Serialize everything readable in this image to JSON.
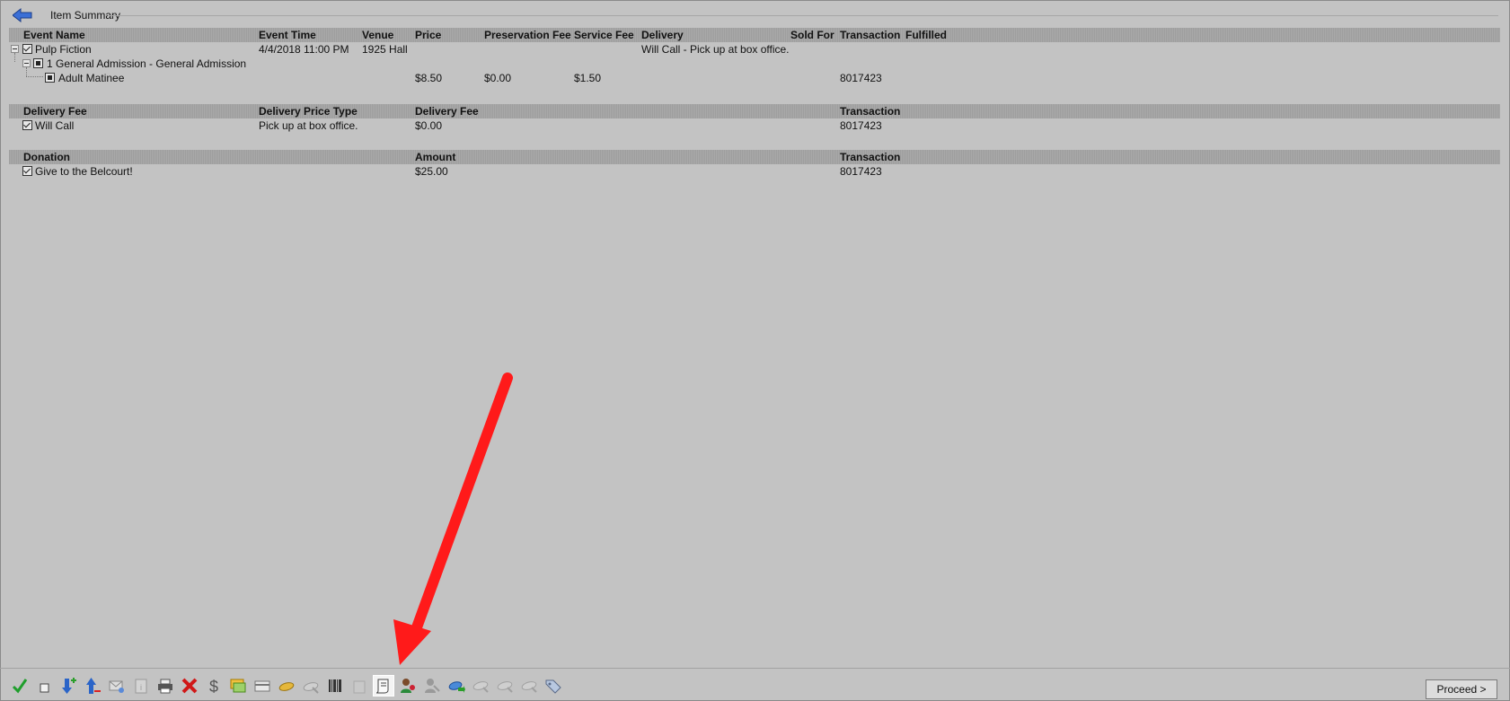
{
  "window": {
    "title": "Item Summary"
  },
  "events": {
    "headers": [
      "Event Name",
      "Event Time",
      "Venue",
      "Price",
      "Preservation Fee",
      "Service Fee",
      "Delivery",
      "Sold For",
      "Transaction",
      "Fulfilled"
    ],
    "event": {
      "name": "Pulp Fiction",
      "time": "4/4/2018 11:00 PM",
      "venue": "1925 Hall",
      "delivery": "Will Call - Pick up at box office."
    },
    "section": {
      "name": "1 General Admission - General Admission"
    },
    "ticket": {
      "name": "Adult Matinee",
      "price": "$8.50",
      "preservation_fee": "$0.00",
      "service_fee": "$1.50",
      "transaction": "8017423"
    }
  },
  "delivery": {
    "headers": [
      "Delivery Fee",
      "Delivery Price Type",
      "Delivery Fee",
      "Transaction"
    ],
    "row": {
      "name": "Will Call",
      "price_type": "Pick up at box office.",
      "fee": "$0.00",
      "transaction": "8017423"
    }
  },
  "donation": {
    "headers": [
      "Donation",
      "Amount",
      "Transaction"
    ],
    "row": {
      "name": "Give to the Belcourt!",
      "amount": "$25.00",
      "transaction": "8017423"
    }
  },
  "toolbar": {
    "icons": [
      "check-icon",
      "checkbox-icon",
      "move-down-icon",
      "move-up-icon",
      "mail-icon",
      "info-icon",
      "print-icon",
      "delete-icon",
      "dollar-icon",
      "exchange-icon",
      "card-icon",
      "ticket-icon",
      "ticket-void-icon",
      "barcode-icon",
      "box-icon",
      "receipt-icon",
      "customer-icon",
      "customer-disabled-icon",
      "ticket-forward-icon",
      "ticket-disabled-icon",
      "ticket-disabled-icon",
      "ticket-disabled-icon",
      "tag-icon"
    ]
  },
  "actions": {
    "proceed_label": "Proceed >"
  },
  "colors": {
    "background": "#c3c3c3",
    "header_band": "#a4a4a4",
    "annotation_arrow": "#ff1a1a"
  }
}
